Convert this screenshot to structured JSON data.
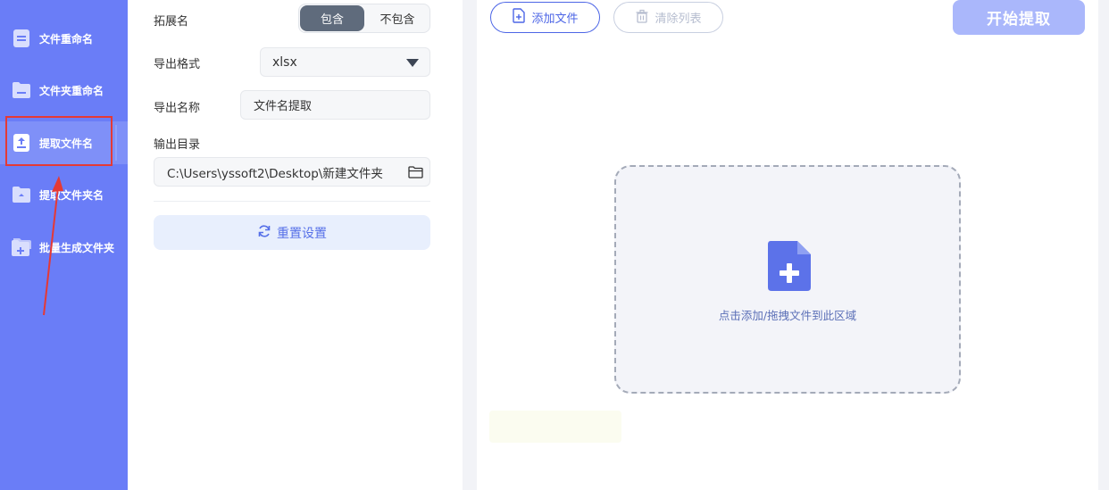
{
  "sidebar": {
    "items": [
      {
        "label": "文件重命名",
        "icon": "document-icon"
      },
      {
        "label": "文件夹重命名",
        "icon": "folder-icon"
      },
      {
        "label": "提取文件名",
        "icon": "upload-icon",
        "active": true
      },
      {
        "label": "提取文件夹名",
        "icon": "folder-upload-icon"
      },
      {
        "label": "批量生成文件夹",
        "icon": "folder-add-icon"
      }
    ]
  },
  "settings": {
    "extension": {
      "label": "拓展名",
      "options": [
        "包含",
        "不包含"
      ],
      "selected": "包含"
    },
    "export_format": {
      "label": "导出格式",
      "value": "xlsx"
    },
    "export_name": {
      "label": "导出名称",
      "value": "文件名提取"
    },
    "output_dir": {
      "label": "输出目录",
      "value": "C:\\Users\\yssoft2\\Desktop\\新建文件夹"
    },
    "reset_label": "重置设置"
  },
  "toolbar": {
    "add_file": "添加文件",
    "clear_list": "清除列表",
    "start": "开始提取"
  },
  "dropzone": {
    "hint": "点击添加/拖拽文件到此区域"
  },
  "colors": {
    "sidebar_bg": "#6a7df7",
    "accent": "#4d66e6",
    "start_button": "#aab7fb",
    "annotation_red": "#e53935"
  }
}
